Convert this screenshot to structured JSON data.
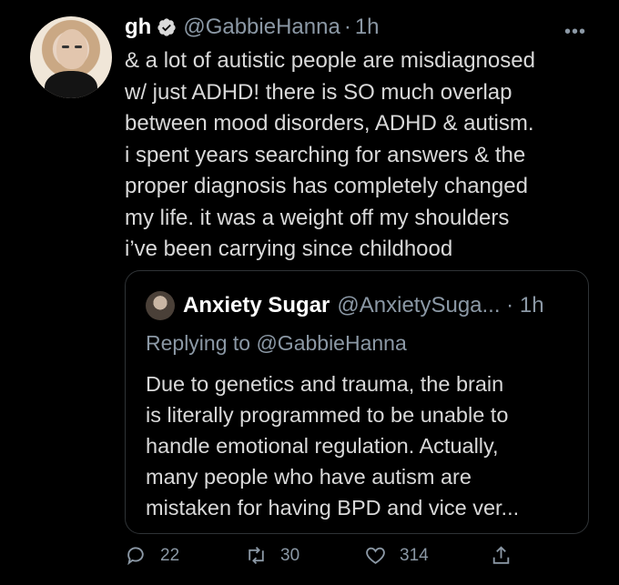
{
  "author": {
    "name": "gh",
    "handle": "@GabbieHanna",
    "separator": "·",
    "time": "1h"
  },
  "more_label": "•••",
  "body": "& a lot of autistic people are misdiagnosed\nw/ just ADHD! there is SO much overlap\nbetween mood disorders, ADHD & autism.\ni spent years searching for answers & the\nproper diagnosis has completely changed\nmy life. it was a weight off my shoulders\ni’ve been carrying since childhood",
  "quote": {
    "name": "Anxiety Sugar",
    "handle": "@AnxietySuga... · 1h",
    "replying_to": "Replying to @GabbieHanna",
    "text": "Due to genetics and trauma, the brain\nis literally programmed to be unable to\nhandle emotional regulation. Actually,\nmany people who have autism are\nmistaken for having BPD and vice ver..."
  },
  "actions": {
    "replies": "22",
    "retweets": "30",
    "likes": "314"
  },
  "colors": {
    "background": "#000000",
    "text": "#d9d9d9",
    "secondary": "#8b98a5",
    "border": "#2f3336"
  }
}
